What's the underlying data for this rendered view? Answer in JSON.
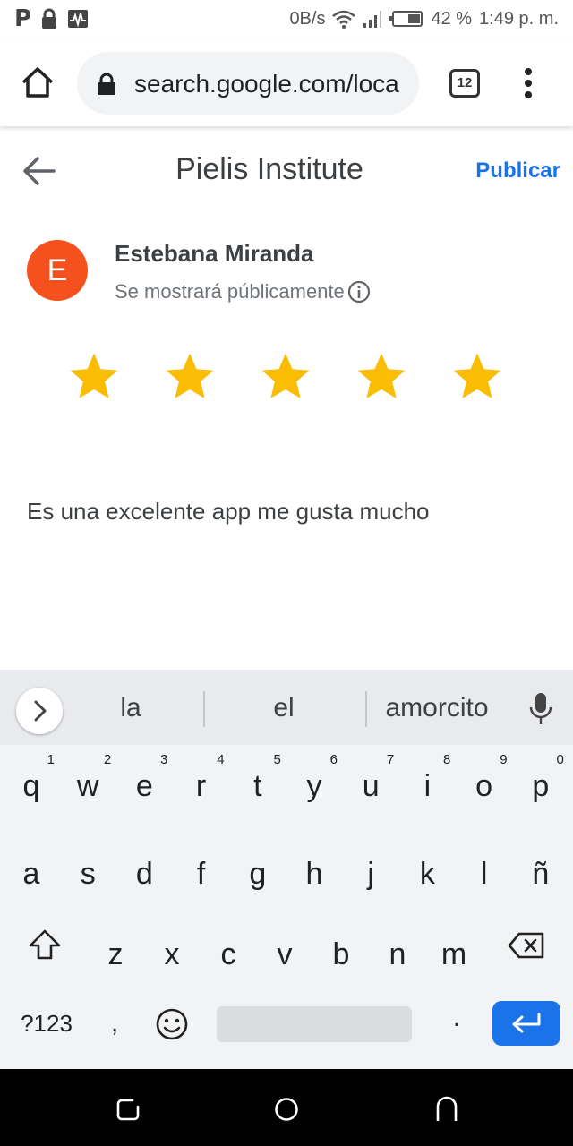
{
  "status_bar": {
    "network_speed": "0B/s",
    "battery": "42 %",
    "time": "1:49 p. m."
  },
  "browser": {
    "url": "search.google.com/loca",
    "tab_count": "12"
  },
  "review": {
    "title": "Pielis Institute",
    "publish_label": "Publicar",
    "author_initial": "E",
    "author_name": "Estebana Miranda",
    "visibility_note": "Se mostrará públicamente",
    "rating": 5,
    "rating_max": 5,
    "text": "Es una excelente app me gusta mucho",
    "star_color": "#fbbc04"
  },
  "keyboard": {
    "suggestions": [
      "la",
      "el",
      "amorcito"
    ],
    "row1": [
      "q",
      "w",
      "e",
      "r",
      "t",
      "y",
      "u",
      "i",
      "o",
      "p"
    ],
    "row1_hints": [
      "1",
      "2",
      "3",
      "4",
      "5",
      "6",
      "7",
      "8",
      "9",
      "0"
    ],
    "row2": [
      "a",
      "s",
      "d",
      "f",
      "g",
      "h",
      "j",
      "k",
      "l",
      "ñ"
    ],
    "row3": [
      "z",
      "x",
      "c",
      "v",
      "b",
      "n",
      "m"
    ],
    "symbols_label": "?123",
    "comma": ",",
    "period": ".",
    "accent_color": "#1a73e8"
  }
}
